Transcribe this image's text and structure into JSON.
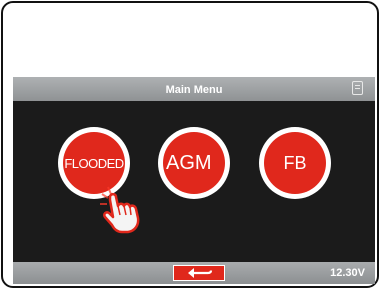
{
  "header": {
    "title": "Main Menu",
    "storage_icon": "sd-card-icon"
  },
  "menu": {
    "items": [
      {
        "label": "FLOODED"
      },
      {
        "label": "AGM"
      },
      {
        "label": "FB"
      }
    ]
  },
  "pointer_icon": "hand-pointer-icon",
  "footer": {
    "back_icon": "return-arrow-icon",
    "voltage": "12.30V"
  },
  "colors": {
    "accent": "#e0281c",
    "screen_bg": "#1b1b1b",
    "bar_gray": "#9c9fa1"
  }
}
